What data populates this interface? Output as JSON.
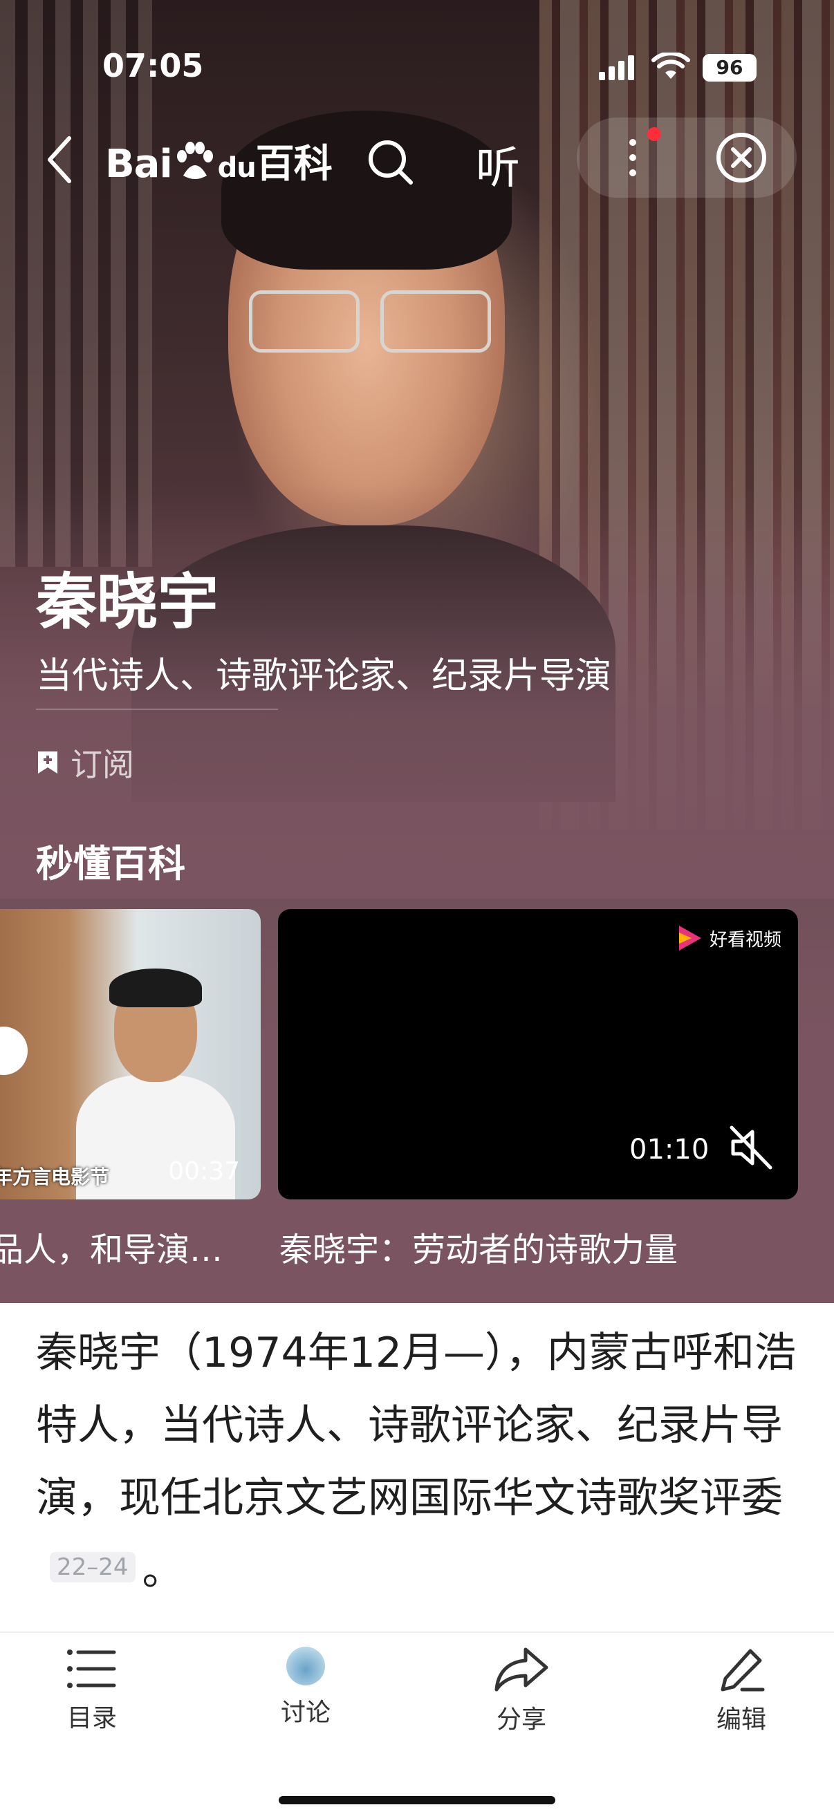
{
  "status_bar": {
    "time": "07:05",
    "battery": "96"
  },
  "nav": {
    "logo_text_left": "Bai",
    "logo_text_paw": "du",
    "logo_text_right": "百科",
    "listen": "听"
  },
  "entry": {
    "title": "秦晓宇",
    "subtitle": "当代诗人、诗歌评论家、纪录片导演",
    "subscribe": "订阅"
  },
  "videos_section": {
    "title": "秒懂百科",
    "items": [
      {
        "caption": "年方言电影节",
        "duration": "00:37",
        "title": "品人，和导演…"
      },
      {
        "brand": "好看视频",
        "duration": "01:10",
        "title": "秦晓宇：劳动者的诗歌力量"
      }
    ]
  },
  "summary": {
    "text": "秦晓宇（1974年12月—），内蒙古呼和浩特人，当代诗人、诗歌评论家、纪录片导演，现任北京文艺网国际华文诗歌奖评委",
    "cite": "22–24",
    "end": "。"
  },
  "bottom_bar": {
    "toc": "目录",
    "discuss": "讨论",
    "share": "分享",
    "edit": "编辑"
  },
  "colors": {
    "hero_bg": "#7a5561",
    "accent_dot": "#ff2d3a"
  }
}
